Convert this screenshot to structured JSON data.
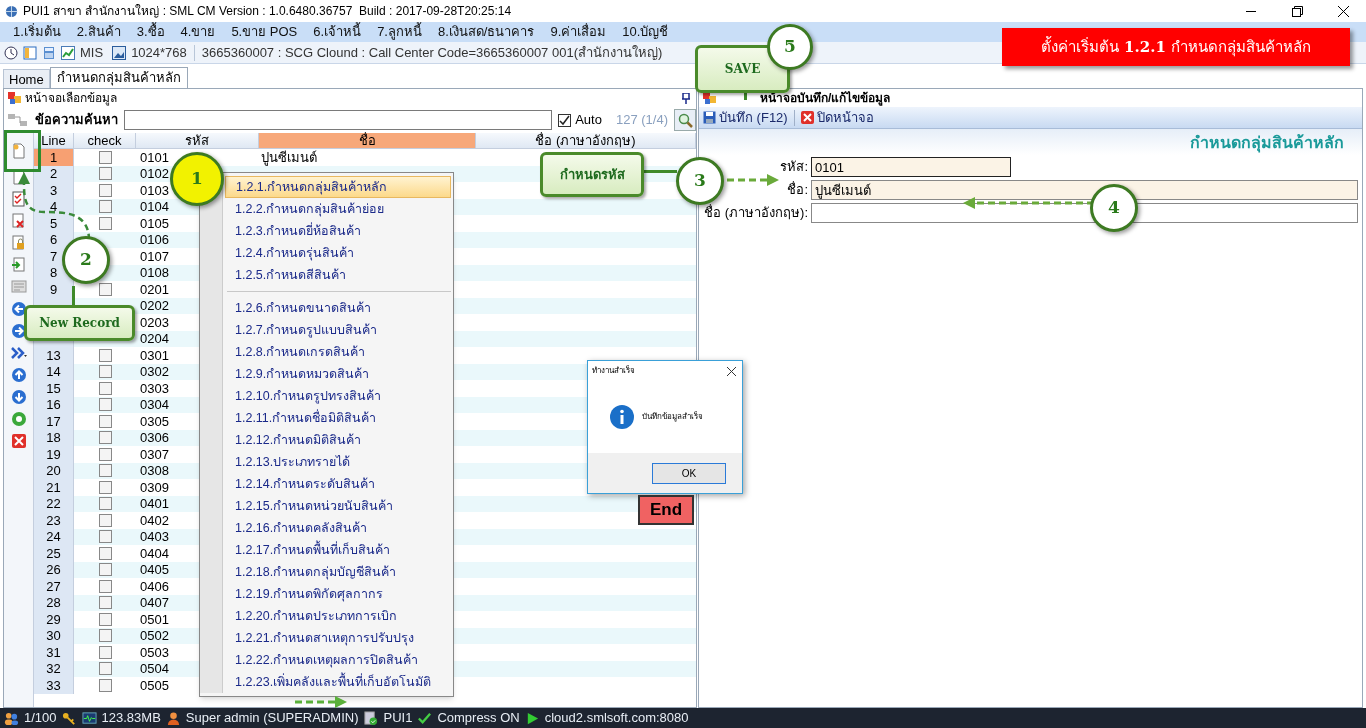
{
  "window": {
    "title": "PUI1 สาขา สำนักงานใหญ่ : SML CM Version : 1.0.6480.36757  Build : 2017-09-28T20:25:14"
  },
  "menu": [
    "1.เริ่มต้น",
    "2.สินค้า",
    "3.ซื้อ",
    "4.ขาย",
    "5.ขาย POS",
    "6.เจ้าหนี้",
    "7.ลูกหนี้",
    "8.เงินสด/ธนาคาร",
    "9.ค่าเสื่อม",
    "10.บัญชี"
  ],
  "toolbar": {
    "mis": "MIS",
    "resolution": "1024*768",
    "info": "3665360007 : SCG Clound : Call Center Code=3665360007 001(สำนักงานใหญ่)"
  },
  "banner": "ตั้งค่าเริ่มต้น **1.2.1** กำหนดกลุ่มสินค้าหลัก",
  "tabs": [
    {
      "label": "Home",
      "selected": false
    },
    {
      "label": "กำหนดกลุ่มสินค้าหลัก",
      "selected": true
    }
  ],
  "list_panel": {
    "title": "หน้าจอเลือกข้อมูล",
    "search_label": "ข้อความค้นหา",
    "auto": {
      "label": "Auto",
      "checked": true
    },
    "count": "127 (1/4)",
    "columns": [
      {
        "label": "Line",
        "selected": false
      },
      {
        "label": "check",
        "selected": false
      },
      {
        "label": "รหัส",
        "selected": false
      },
      {
        "label": "ชื่อ",
        "selected": true
      },
      {
        "label": "ชื่อ (ภาษาอังกฤษ)",
        "selected": false
      }
    ],
    "rows": [
      {
        "line": "1",
        "code": "0101",
        "name": "ปูนซีเมนต์",
        "checked": false,
        "selected": true
      },
      {
        "line": "2",
        "code": "0102",
        "checked": false,
        "selected": false
      },
      {
        "line": "3",
        "code": "0103",
        "checked": false,
        "selected": false
      },
      {
        "line": "4",
        "code": "0104",
        "checked": false,
        "selected": false
      },
      {
        "line": "5",
        "code": "0105",
        "checked": false,
        "selected": false
      },
      {
        "line": "6",
        "code": "0106",
        "selected": false
      },
      {
        "line": "7",
        "code": "0107",
        "selected": false
      },
      {
        "line": "8",
        "code": "0108",
        "selected": false
      },
      {
        "line": "9",
        "code": "0201",
        "checked": false,
        "selected": false
      },
      {
        "code": "0202"
      },
      {
        "code": "0203"
      },
      {
        "code": "0204"
      },
      {
        "line": "13",
        "code": "0301",
        "checked": false,
        "selected": false
      },
      {
        "line": "14",
        "code": "0302",
        "checked": false,
        "selected": false
      },
      {
        "line": "15",
        "code": "0303",
        "checked": false,
        "selected": false
      },
      {
        "line": "16",
        "code": "0304",
        "checked": false,
        "selected": false
      },
      {
        "line": "17",
        "code": "0305",
        "checked": false,
        "selected": false
      },
      {
        "line": "18",
        "code": "0306",
        "checked": false,
        "selected": false
      },
      {
        "line": "19",
        "code": "0307",
        "checked": false,
        "selected": false
      },
      {
        "line": "20",
        "code": "0308",
        "checked": false,
        "selected": false
      },
      {
        "line": "21",
        "code": "0309",
        "checked": false,
        "selected": false
      },
      {
        "line": "22",
        "code": "0401",
        "checked": false,
        "selected": false
      },
      {
        "line": "23",
        "code": "0402",
        "checked": false,
        "selected": false
      },
      {
        "line": "24",
        "code": "0403",
        "checked": false,
        "selected": false
      },
      {
        "line": "25",
        "code": "0404",
        "checked": false,
        "selected": false
      },
      {
        "line": "26",
        "code": "0405",
        "checked": false,
        "selected": false
      },
      {
        "line": "27",
        "code": "0406",
        "checked": false,
        "selected": false
      },
      {
        "line": "28",
        "code": "0407",
        "checked": false,
        "selected": false
      },
      {
        "line": "29",
        "code": "0501",
        "checked": false,
        "selected": false
      },
      {
        "line": "30",
        "code": "0502",
        "checked": false,
        "selected": false
      },
      {
        "line": "31",
        "code": "0503",
        "checked": false,
        "selected": false
      },
      {
        "line": "32",
        "code": "0504",
        "checked": false,
        "selected": false
      },
      {
        "line": "33",
        "code": "0505",
        "checked": false,
        "selected": false
      }
    ]
  },
  "context_menu": [
    {
      "label": "1.2.1.กำหนดกลุ่มสินค้าหลัก",
      "selected": true
    },
    {
      "label": "1.2.2.กำหนดกลุ่มสินค้าย่อย",
      "selected": false
    },
    {
      "label": "1.2.3.กำหนดยี่ห้อสินค้า",
      "selected": false
    },
    {
      "label": "1.2.4.กำหนดรุ่นสินค้า",
      "selected": false
    },
    {
      "label": "1.2.5.กำหนดสีสินค้า",
      "selected": false,
      "separator_after": true
    },
    {
      "label": "1.2.6.กำหนดขนาดสินค้า",
      "selected": false
    },
    {
      "label": "1.2.7.กำหนดรูปแบบสินค้า",
      "selected": false
    },
    {
      "label": "1.2.8.กำหนดเกรดสินค้า",
      "selected": false
    },
    {
      "label": "1.2.9.กำหนดหมวดสินค้า",
      "selected": false
    },
    {
      "label": "1.2.10.กำหนดรูปทรงสินค้า",
      "selected": false
    },
    {
      "label": "1.2.11.กำหนดชื่อมิติสินค้า",
      "selected": false
    },
    {
      "label": "1.2.12.กำหนดมิติสินค้า",
      "selected": false
    },
    {
      "label": "1.2.13.ประเภทรายได้",
      "selected": false
    },
    {
      "label": "1.2.14.กำหนดระดับสินค้า",
      "selected": false
    },
    {
      "label": "1.2.15.กำหนดหน่วยนับสินค้า",
      "selected": false
    },
    {
      "label": "1.2.16.กำหนดคลังสินค้า",
      "selected": false
    },
    {
      "label": "1.2.17.กำหนดพื้นที่เก็บสินค้า",
      "selected": false
    },
    {
      "label": "1.2.18.กำหนดกลุ่มบัญชีสินค้า",
      "selected": false
    },
    {
      "label": "1.2.19.กำหนดพิกัดศุลกากร",
      "selected": false
    },
    {
      "label": "1.2.20.กำหนดประเภทการเบิก",
      "selected": false
    },
    {
      "label": "1.2.21.กำหนดสาเหตุการปรับปรุง",
      "selected": false
    },
    {
      "label": "1.2.22.กำหนดเหตุผลการปิดสินค้า",
      "selected": false
    },
    {
      "label": "1.2.23.เพิ่มคลังและพื้นที่เก็บอัตโนมัติ",
      "selected": false
    }
  ],
  "edit_panel": {
    "title": "หน้าจอบันทึก/แก้ไขข้อมูล",
    "save": "บันทึก (F12)",
    "close": "ปิดหน้าจอ",
    "heading": "กำหนดกลุ่มสินค้าหลัก",
    "fields": [
      {
        "label": "รหัส:",
        "value": "0101",
        "kind": "short"
      },
      {
        "label": "ชื่อ:",
        "value": "ปูนซีเมนต์",
        "kind": "wide"
      },
      {
        "label": "ชื่อ (ภาษาอังกฤษ):",
        "kind": "wide"
      }
    ]
  },
  "dialog": {
    "title": "ทำงานสำเร็จ",
    "message": "บันทึกข้อมูลสำเร็จ",
    "ok": "OK"
  },
  "end_button": "End",
  "callouts": [
    {
      "label": "1",
      "color": "#f2f200"
    },
    {
      "label": "2",
      "color": "#ffffff"
    },
    {
      "label": "3",
      "color": "#ffffff"
    },
    {
      "label": "4",
      "color": "#ffffff"
    },
    {
      "label": "5",
      "color": "#ffffff"
    }
  ],
  "notes": [
    "New Record",
    "กำหนดรหัส",
    "SAVE"
  ],
  "status_bar": [
    "1/100",
    "123.83MB",
    "Super admin (SUPERADMIN)",
    "PUI1",
    "Compress ON",
    "cloud2.smlsoft.com:8080"
  ]
}
